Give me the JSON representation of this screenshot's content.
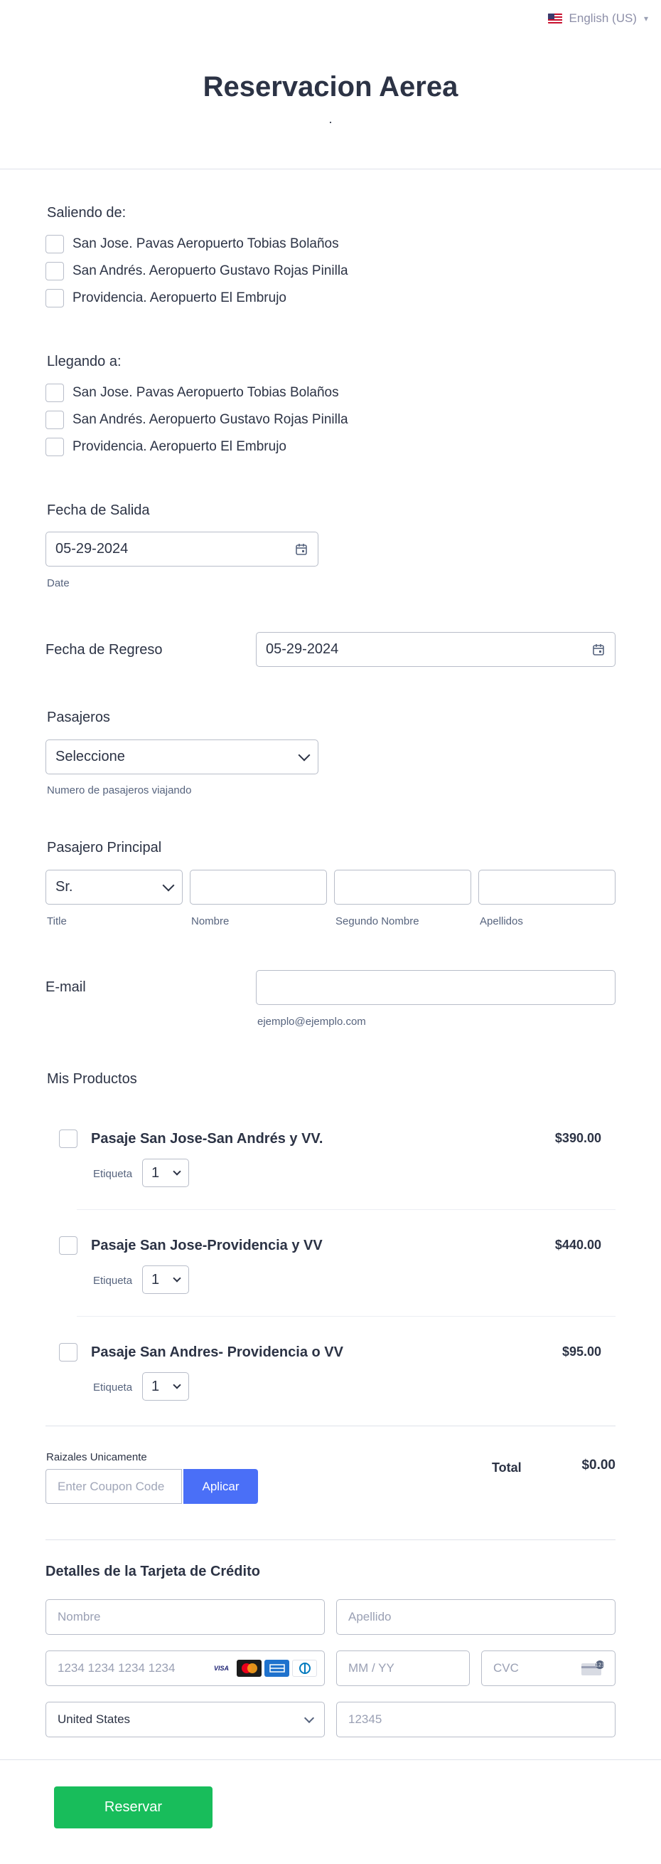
{
  "language": {
    "label": "English (US)"
  },
  "header": {
    "title": "Reservacion Aerea",
    "subtitle": "."
  },
  "saliendo": {
    "label": "Saliendo de:",
    "options": [
      "San Jose. Pavas Aeropuerto Tobias Bolaños",
      "San Andrés. Aeropuerto Gustavo Rojas Pinilla",
      "Providencia. Aeropuerto El Embrujo"
    ]
  },
  "llegando": {
    "label": "Llegando a:",
    "options": [
      "San Jose. Pavas Aeropuerto Tobias Bolaños",
      "San Andrés. Aeropuerto Gustavo Rojas Pinilla",
      "Providencia. Aeropuerto El Embrujo"
    ]
  },
  "fecha_salida": {
    "label": "Fecha de Salida",
    "value": "05-29-2024",
    "sublabel": "Date"
  },
  "fecha_regreso": {
    "label": "Fecha de Regreso",
    "value": "05-29-2024"
  },
  "pasajeros": {
    "label": "Pasajeros",
    "value": "Seleccione",
    "sublabel": "Numero de pasajeros viajando"
  },
  "pasajero_principal": {
    "label": "Pasajero Principal",
    "title_value": "Sr.",
    "sublabels": [
      "Title",
      "Nombre",
      "Segundo Nombre",
      "Apellidos"
    ]
  },
  "email": {
    "label": "E-mail",
    "sublabel": "ejemplo@ejemplo.com"
  },
  "productos": {
    "label": "Mis Productos",
    "qty_label": "Etiqueta",
    "items": [
      {
        "name": "Pasaje San Jose-San Andrés y VV.",
        "price": "$390.00",
        "qty": "1"
      },
      {
        "name": "Pasaje San Jose-Providencia y VV",
        "price": "$440.00",
        "qty": "1"
      },
      {
        "name": "Pasaje San Andres- Providencia o VV",
        "price": "$95.00",
        "qty": "1"
      }
    ]
  },
  "coupon": {
    "label": "Raizales Unicamente",
    "placeholder": "Enter Coupon Code",
    "button": "Aplicar"
  },
  "total": {
    "label": "Total",
    "value": "$0.00"
  },
  "tarjeta": {
    "title": "Detalles de la Tarjeta de Crédito",
    "nombre_placeholder": "Nombre",
    "apellido_placeholder": "Apellido",
    "card_placeholder": "1234 1234 1234 1234",
    "expiry_placeholder": "MM / YY",
    "cvc_placeholder": "CVC",
    "country": "United States",
    "zip_placeholder": "12345",
    "card_brands": [
      "VISA",
      "mastercard",
      "amex",
      "diners"
    ]
  },
  "submit": {
    "label": "Reservar"
  },
  "colors": {
    "primary_button": "#4a6ff7",
    "submit_button": "#18bd5b",
    "text": "#2c3345"
  }
}
